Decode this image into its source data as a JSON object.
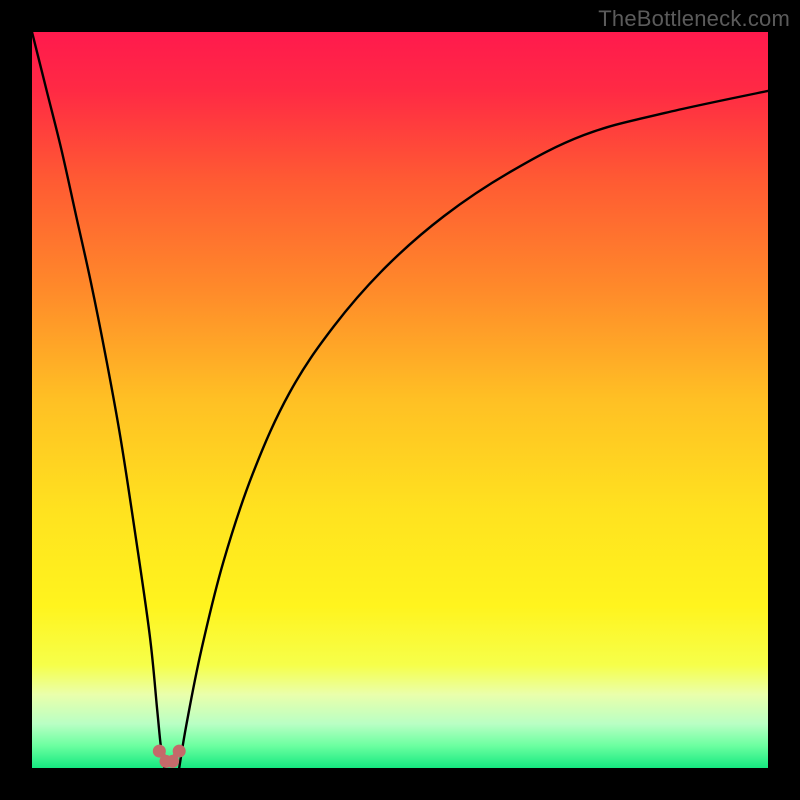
{
  "watermark": "TheBottleneck.com",
  "chart_data": {
    "type": "line",
    "title": "",
    "xlabel": "",
    "ylabel": "",
    "xlim": [
      0,
      100
    ],
    "ylim": [
      0,
      100
    ],
    "grid": false,
    "legend": false,
    "background_gradient": {
      "stops": [
        {
          "pos": 0.0,
          "color": "#ff1a4d"
        },
        {
          "pos": 0.08,
          "color": "#ff2a44"
        },
        {
          "pos": 0.2,
          "color": "#ff5a33"
        },
        {
          "pos": 0.35,
          "color": "#ff8a2a"
        },
        {
          "pos": 0.5,
          "color": "#ffc024"
        },
        {
          "pos": 0.65,
          "color": "#ffe21f"
        },
        {
          "pos": 0.78,
          "color": "#fff41e"
        },
        {
          "pos": 0.86,
          "color": "#f6ff4a"
        },
        {
          "pos": 0.9,
          "color": "#eaffab"
        },
        {
          "pos": 0.94,
          "color": "#b9ffc4"
        },
        {
          "pos": 0.97,
          "color": "#6bffa0"
        },
        {
          "pos": 1.0,
          "color": "#15e880"
        }
      ]
    },
    "series": [
      {
        "name": "left-branch",
        "x": [
          0,
          2,
          4,
          6,
          8,
          10,
          12,
          14,
          16,
          17,
          17.5,
          18
        ],
        "y": [
          100,
          92,
          84,
          75,
          66,
          56,
          45,
          32,
          18,
          8,
          3,
          0
        ]
      },
      {
        "name": "right-branch",
        "x": [
          20,
          21,
          23,
          26,
          30,
          35,
          41,
          48,
          56,
          65,
          75,
          86,
          100
        ],
        "y": [
          0,
          6,
          16,
          28,
          40,
          51,
          60,
          68,
          75,
          81,
          86,
          89,
          92
        ]
      }
    ],
    "markers": {
      "name": "bottom-dip-points",
      "color": "#c46a6a",
      "points": [
        {
          "x": 17.3,
          "y": 2.3
        },
        {
          "x": 18.2,
          "y": 0.9
        },
        {
          "x": 19.1,
          "y": 0.9
        },
        {
          "x": 20.0,
          "y": 2.3
        }
      ]
    }
  }
}
